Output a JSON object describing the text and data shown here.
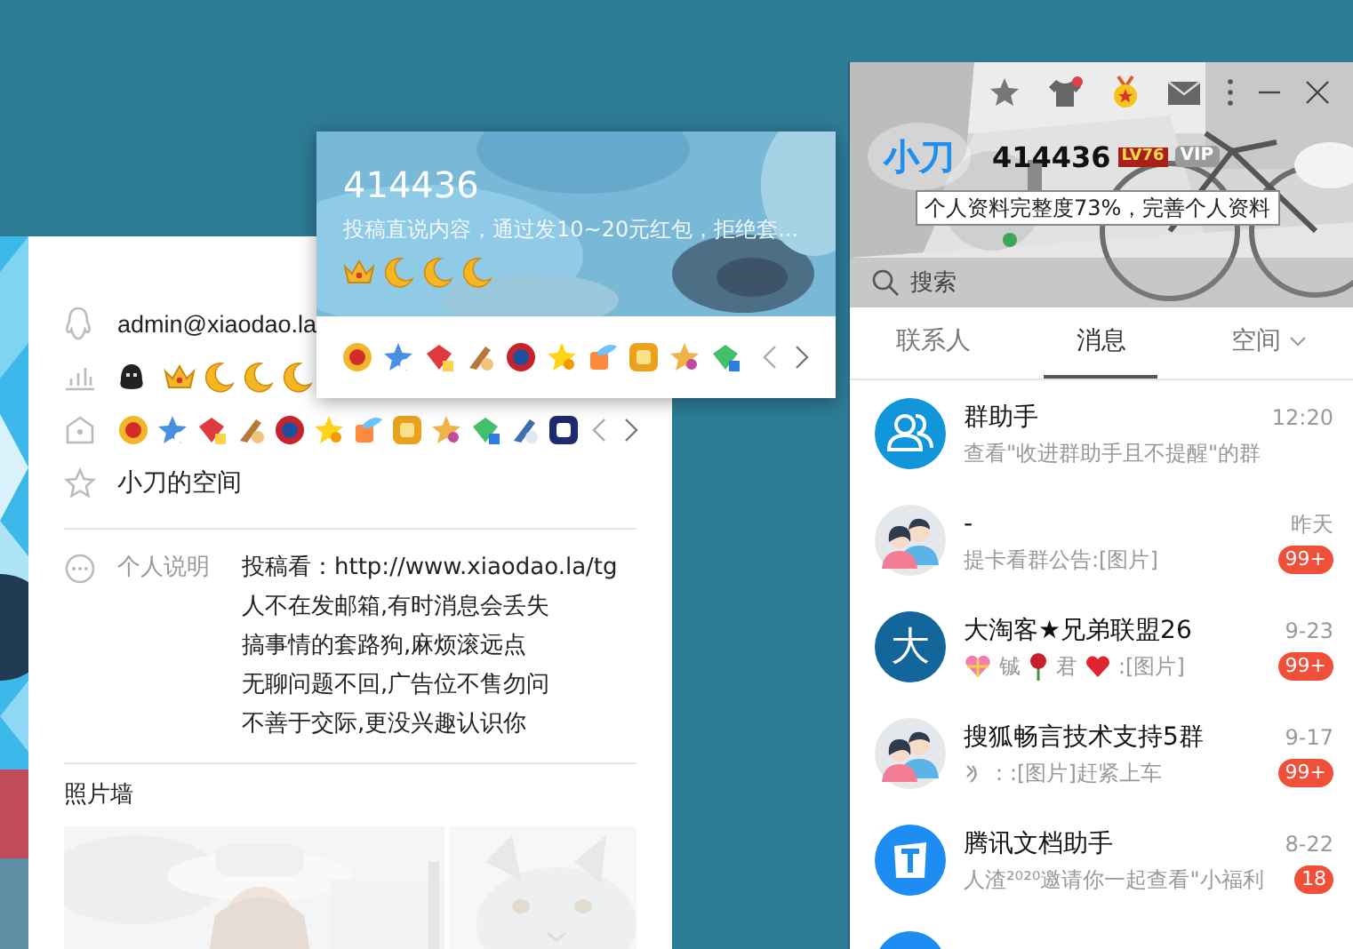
{
  "profile": {
    "email": "admin@xiaodao.la",
    "space_name": "小刀的空间",
    "bio_label": "个人说明",
    "bio_lines": [
      "投稿看：http://www.xiaodao.la/tg",
      "人不在发邮箱,有时消息会丢失",
      "搞事情的套路狗,麻烦滚远点",
      "无聊问题不回,广告位不售勿问",
      "不善于交际,更没兴趣认识你"
    ],
    "photo_wall_title": "照片墙"
  },
  "card": {
    "qq_number": "414436",
    "signature": "投稿直说内容，通过发10~20元红包，拒绝套..."
  },
  "panel": {
    "nickname": "小刀",
    "qq_number": "414436",
    "level_badge": "LV76",
    "vip_badge": "VIP",
    "tooltip": "个人资料完整度73%，完善个人资料",
    "search": {
      "placeholder": "搜索"
    },
    "tabs": [
      {
        "label": "联系人",
        "selected": false,
        "dropdown": false
      },
      {
        "label": "消息",
        "selected": true,
        "dropdown": false
      },
      {
        "label": "空间",
        "selected": false,
        "dropdown": true
      }
    ],
    "messages": [
      {
        "kind": "group-helper",
        "name": "群助手",
        "preview": [
          {
            "kind": "text",
            "text": "查看\"收进群助手且不提醒\"的群"
          }
        ],
        "time": "12:20"
      },
      {
        "kind": "people",
        "name": "-",
        "preview": [
          {
            "kind": "text",
            "text": "提卡看群公告:[图片]"
          }
        ],
        "time": "昨天",
        "unread": "99+"
      },
      {
        "kind": "letter",
        "avatar_text": "大",
        "name": "大淘客★兄弟联盟26",
        "preview": [
          {
            "kind": "gift"
          },
          {
            "kind": "text",
            "text": "铖"
          },
          {
            "kind": "rose"
          },
          {
            "kind": "text",
            "text": "君"
          },
          {
            "kind": "heart"
          },
          {
            "kind": "text",
            "text": ":[图片]"
          }
        ],
        "time": "9-23",
        "unread": "99+"
      },
      {
        "kind": "people",
        "name": "搜狐畅言技术支持5群",
        "preview": [
          {
            "kind": "squiggle"
          },
          {
            "kind": "text",
            "text": "：:[图片]赶紧上车"
          }
        ],
        "time": "9-17",
        "unread": "99+"
      },
      {
        "kind": "doc",
        "name": "腾讯文档助手",
        "preview": [
          {
            "kind": "text",
            "text": "人渣²⁰²⁰邀请你一起查看\"小福利"
          }
        ],
        "time": "8-22",
        "unread": "18"
      },
      {
        "kind": "plain"
      }
    ]
  }
}
